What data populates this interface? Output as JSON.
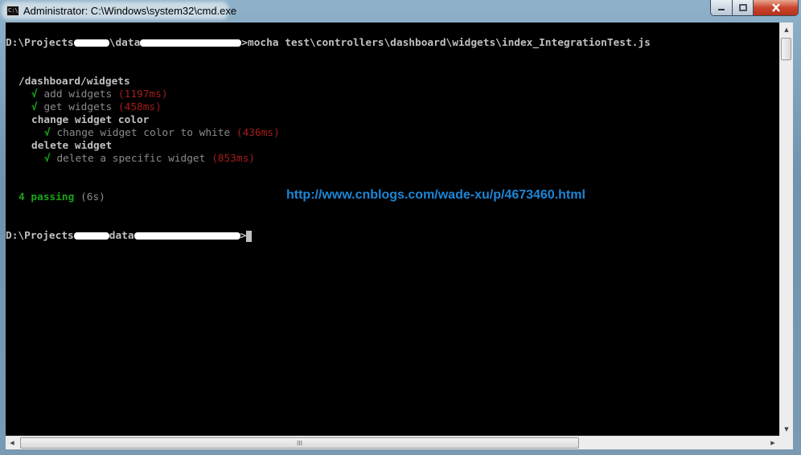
{
  "window": {
    "title": "Administrator: C:\\Windows\\system32\\cmd.exe",
    "icon": "cmd-icon",
    "controls": {
      "minimize": "minimize-icon",
      "maximize": "maximize-icon",
      "close": "close-icon"
    }
  },
  "console": {
    "prompt1": {
      "prefix": "D:\\Projects",
      "sep": "\\data",
      "command": ">mocha test\\controllers\\dashboard\\widgets\\index_IntegrationTest.js"
    },
    "suite": "/dashboard/widgets",
    "tests": [
      {
        "check": "√",
        "name": "add widgets",
        "time": "(1197ms)"
      },
      {
        "check": "√",
        "name": "get widgets",
        "time": "(458ms)"
      }
    ],
    "group1": "change widget color",
    "group1_test": {
      "check": "√",
      "name": "change widget color to white",
      "time": "(436ms)"
    },
    "group2": "delete widget",
    "group2_test": {
      "check": "√",
      "name": "delete a specific widget",
      "time": "(853ms)"
    },
    "passing": "4 passing",
    "duration": "(6s)",
    "prompt2": {
      "prefix": "D:\\Projects",
      "sep": "data",
      "end": ">"
    }
  },
  "watermark": "http://www.cnblogs.com/wade-xu/p/4673460.html",
  "scrollbar": {
    "thumb_grip": "III"
  },
  "colors": {
    "pass_green": "#17a317",
    "time_red": "#a51b1b",
    "link_blue": "#1c86d6"
  }
}
